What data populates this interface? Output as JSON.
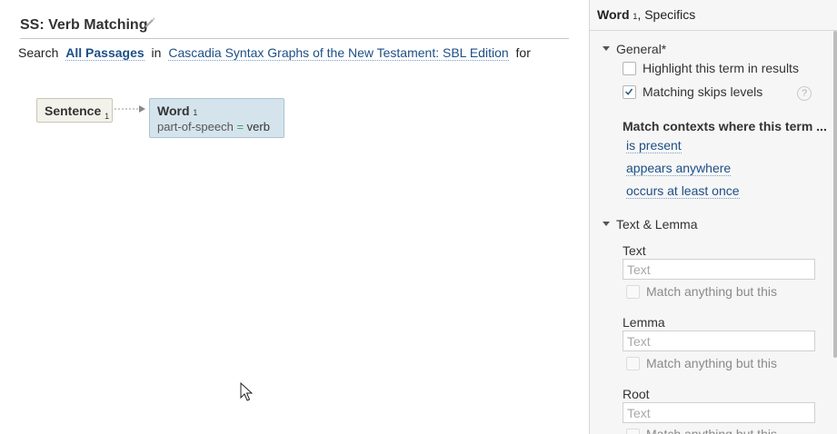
{
  "left": {
    "title": "SS: Verb Matching",
    "search": {
      "search_label": "Search",
      "scope": "All Passages",
      "in_label": "in",
      "resource": "Cascadia Syntax Graphs of the New Testament: SBL Edition",
      "for_label": "for"
    },
    "graph": {
      "sentence_label": "Sentence",
      "sentence_sub": "1",
      "word_label": "Word",
      "word_sub": "1",
      "attr_name": "part-of-speech",
      "attr_op": "=",
      "attr_value": "verb"
    }
  },
  "right": {
    "header_title": "Word",
    "header_sub": "1",
    "header_suffix": "Specifics",
    "general": {
      "label": "General*",
      "highlight_label": "Highlight this term in results",
      "highlight_checked": false,
      "skips_label": "Matching skips levels",
      "skips_checked": true,
      "help": "?",
      "contexts_heading": "Match contexts where this term ...",
      "options": [
        "is present",
        "appears anywhere",
        "occurs at least once"
      ]
    },
    "text_lemma": {
      "label": "Text & Lemma",
      "text_label": "Text",
      "text_placeholder": "Text",
      "text_value": "",
      "text_negate": "Match anything but this",
      "lemma_label": "Lemma",
      "lemma_placeholder": "Text",
      "lemma_value": "",
      "lemma_negate": "Match anything but this",
      "root_label": "Root",
      "root_placeholder": "Text",
      "root_value": "",
      "root_negate": "Match anything but this"
    }
  },
  "colors": {
    "link": "#1d4f86",
    "word_node_bg": "#d5e4ec",
    "sentence_node_bg": "#f3f2ea",
    "equals": "#3aa34a",
    "panel_bg": "#f6f6f6"
  },
  "icons": [
    "pencil-icon",
    "arrow-right-icon",
    "checkmark-icon",
    "help-icon",
    "mouse-cursor-icon",
    "triangle-down-icon"
  ]
}
